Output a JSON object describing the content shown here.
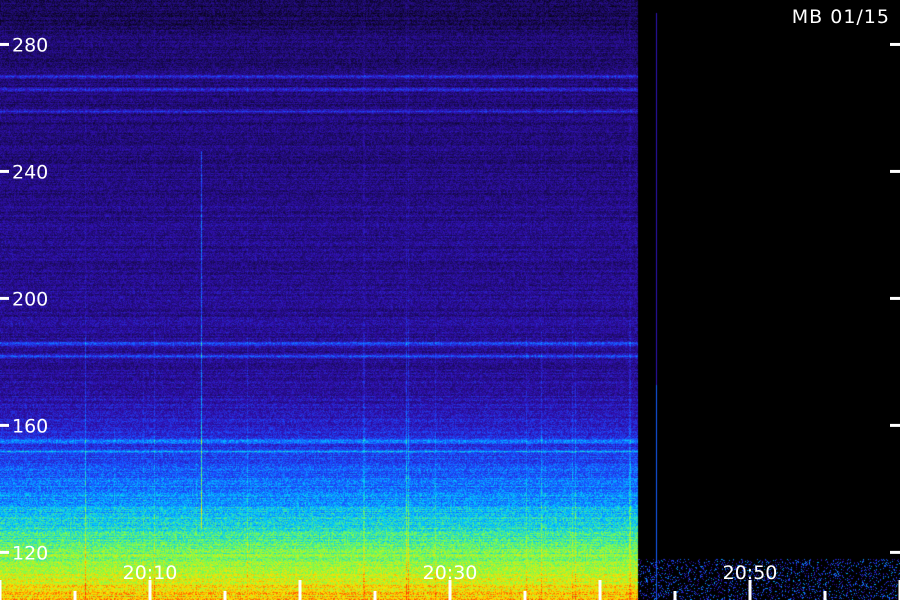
{
  "chart_data": {
    "type": "heatmap",
    "title": "MB 01/15",
    "xlabel": "",
    "ylabel": "",
    "y_ticks": [
      120,
      160,
      200,
      240,
      280
    ],
    "x_ticks": [
      "20:10",
      "20:30",
      "20:50"
    ],
    "x_tick_minutes": [
      10,
      30,
      50
    ],
    "xlim_minutes": [
      0,
      60
    ],
    "ylim": [
      105,
      294
    ],
    "data_end_minute": 42.5,
    "colormap": [
      "#000000",
      "#1a0a5c",
      "#3010b0",
      "#1a4cff",
      "#00c8ff",
      "#7cff4a",
      "#ffe000",
      "#ff3000"
    ],
    "background": "#000000",
    "tick_color": "#ffffff",
    "grid": false,
    "bands": [
      {
        "freq": 270,
        "intensity": 0.55
      },
      {
        "freq": 266,
        "intensity": 0.5
      },
      {
        "freq": 259,
        "intensity": 0.45
      },
      {
        "freq": 186,
        "intensity": 0.55
      },
      {
        "freq": 182,
        "intensity": 0.5
      },
      {
        "freq": 155,
        "intensity": 0.45
      },
      {
        "freq": 152,
        "intensity": 0.4
      }
    ]
  }
}
